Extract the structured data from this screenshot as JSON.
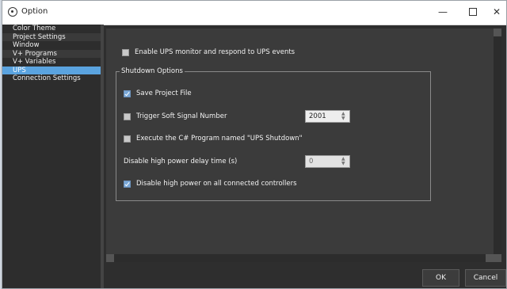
{
  "window": {
    "title": "Option",
    "minimize_glyph": "—",
    "close_glyph": "✕"
  },
  "sidebar": {
    "items": [
      {
        "label": "Color Theme"
      },
      {
        "label": "Project Settings"
      },
      {
        "label": "Window"
      },
      {
        "label": "V+ Programs"
      },
      {
        "label": "V+ Variables"
      },
      {
        "label": "UPS"
      },
      {
        "label": "Connection Settings"
      }
    ],
    "selected": "UPS"
  },
  "ups": {
    "enable_label": "Enable UPS monitor and respond to UPS events",
    "enable_checked": false,
    "group_title": "Shutdown Options",
    "save_project_label": "Save Project File",
    "save_project_checked": true,
    "trigger_signal_label": "Trigger Soft Signal Number",
    "trigger_signal_checked": false,
    "trigger_signal_value": "2001",
    "execute_program_label": "Execute the C# Program named \"UPS Shutdown\"",
    "execute_program_checked": false,
    "delay_label": "Disable high power delay time (s)",
    "delay_value": "0",
    "disable_power_label": "Disable high power on all connected controllers",
    "disable_power_checked": true
  },
  "buttons": {
    "ok": "OK",
    "cancel": "Cancel"
  },
  "colors": {
    "selection_blue": "#5aa3df",
    "checked_blue": "#7aa7d6",
    "panel_bg": "#3b3b3b",
    "sidebar_bg": "#2d2d2d"
  }
}
